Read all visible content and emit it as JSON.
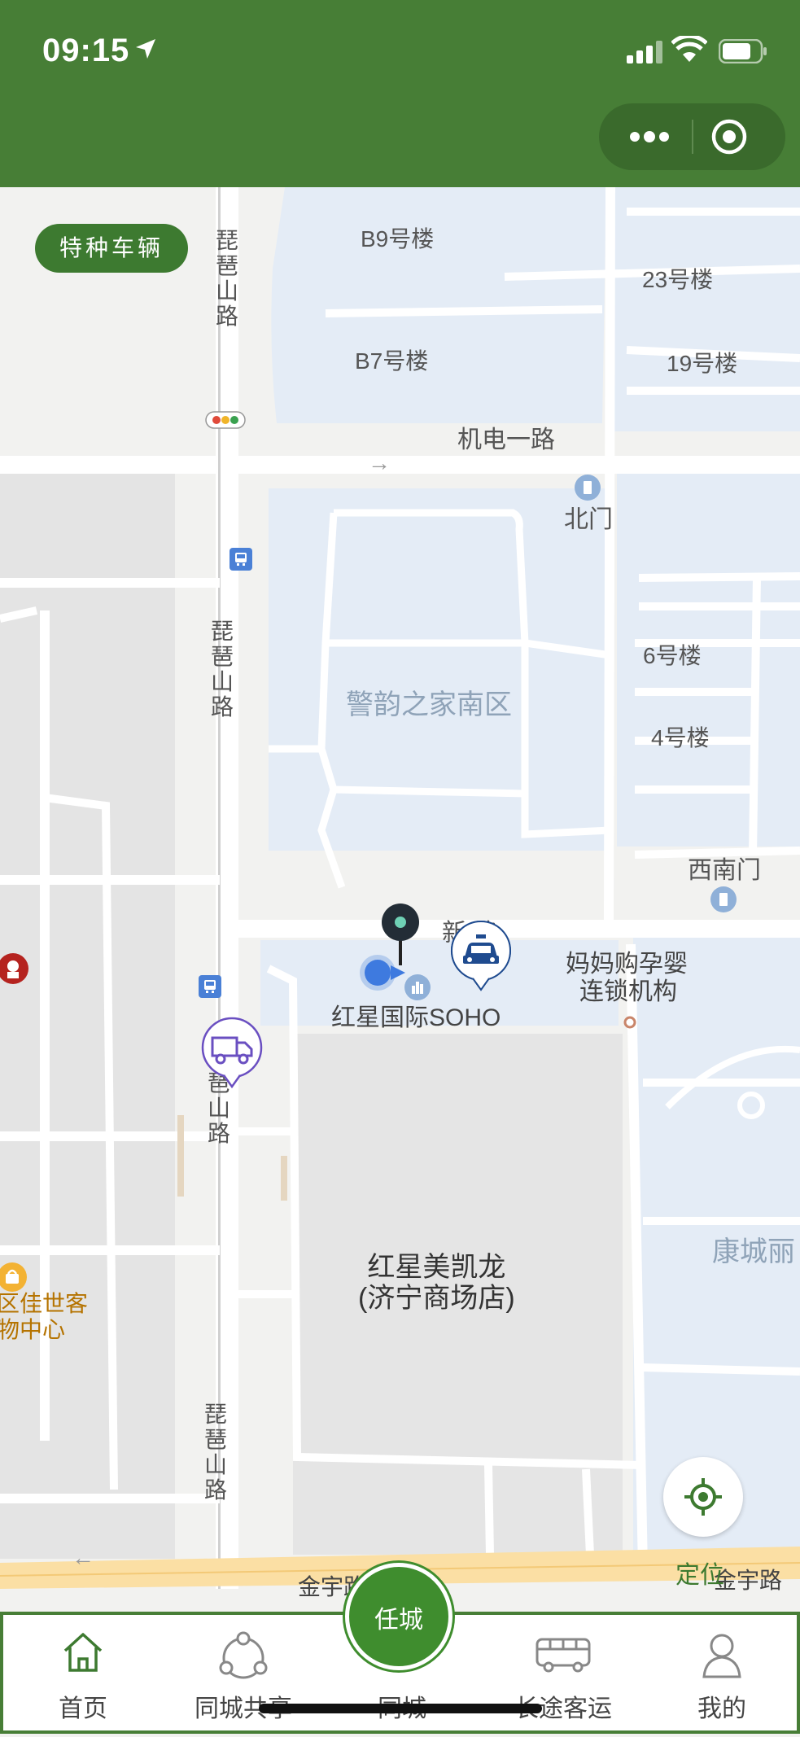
{
  "status_bar": {
    "time": "09:15"
  },
  "capsule": {
    "more_icon": "more-dots-icon",
    "close_icon": "target-icon"
  },
  "map": {
    "special_vehicle_button": "特种车辆",
    "buildings": {
      "b9": "B9号楼",
      "b7": "B7号楼",
      "b23": "23号楼",
      "b19": "19号楼",
      "b6": "6号楼",
      "b4": "4号楼"
    },
    "roads": {
      "pipa_road_1": "琵琶山路",
      "pipa_road_2": "琵琶山路",
      "pipa_road_3": "琶山路",
      "pipa_road_4": "琵琶山路",
      "jidian_road": "机电一路",
      "xin_road": "新 路",
      "jinyu_road_left": "金宇路",
      "jinyu_road_right": "金宇路"
    },
    "gates": {
      "north_gate": "北门",
      "southwest_gate": "西南门"
    },
    "area_name": "警韵之家南区",
    "soho_label": "红星国际SOHO",
    "maternity_label_1": "妈妈购孕婴",
    "maternity_label_2": "连锁机构",
    "mall_line_1": "红星美凯龙",
    "mall_line_2": "(济宁商场店)",
    "jiashi_line_1": "区佳世客",
    "jiashi_line_2": "物中心",
    "kangcheng_label": "康城丽",
    "locate_label": "定位"
  },
  "tabbar": {
    "home": "首页",
    "share": "同城共享",
    "center_button": "任城",
    "city": "同城",
    "long_distance": "长途客运",
    "mine": "我的"
  },
  "colors": {
    "header_green": "#477e36",
    "accent_green": "#3f8d2e",
    "residential_blue": "#e4ecf6",
    "map_bg": "#f2f2f0"
  }
}
